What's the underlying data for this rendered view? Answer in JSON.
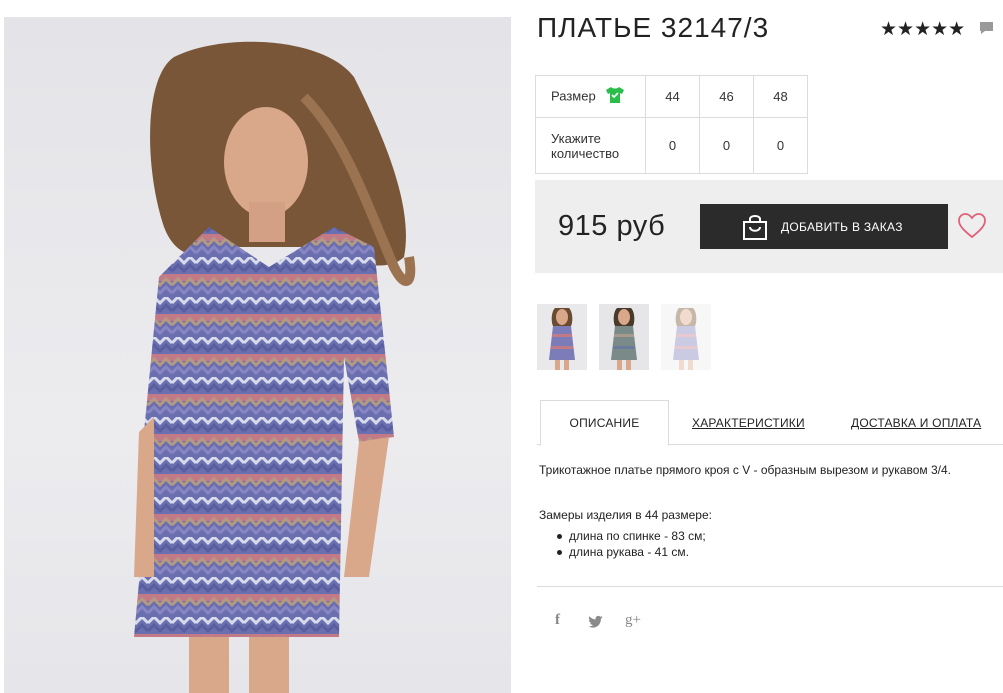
{
  "product": {
    "title": "ПЛАТЬЕ 32147/3",
    "rating_stars": "★★★★★",
    "rating": 5,
    "price": "915 руб"
  },
  "sizes": {
    "size_label": "Размер",
    "qty_label_1": "Укажите",
    "qty_label_2": "количество",
    "values": [
      "44",
      "46",
      "48"
    ],
    "quantities": [
      "0",
      "0",
      "0"
    ]
  },
  "actions": {
    "add_to_order": "ДОБАВИТЬ В ЗАКАЗ"
  },
  "tabs": {
    "description": "ОПИСАНИЕ",
    "characteristics": "ХАРАКТЕРИСТИКИ",
    "delivery": "ДОСТАВКА И ОПЛАТА"
  },
  "description": {
    "text": "Трикотажное платье прямого кроя с V - образным вырезом и рукавом 3/4.",
    "measure_title": "Замеры изделия в 44 размере:",
    "measures": [
      "длина по спинке - 83 см;",
      "длина рукава - 41 см."
    ]
  },
  "social": {
    "facebook": "f",
    "twitter": "🐦",
    "googleplus": "g+"
  },
  "colors": {
    "button_bg": "#2b2b2b",
    "price_box_bg": "#eeeeee",
    "shirt_icon": "#2bbd4a",
    "heart": "#e0607a"
  }
}
